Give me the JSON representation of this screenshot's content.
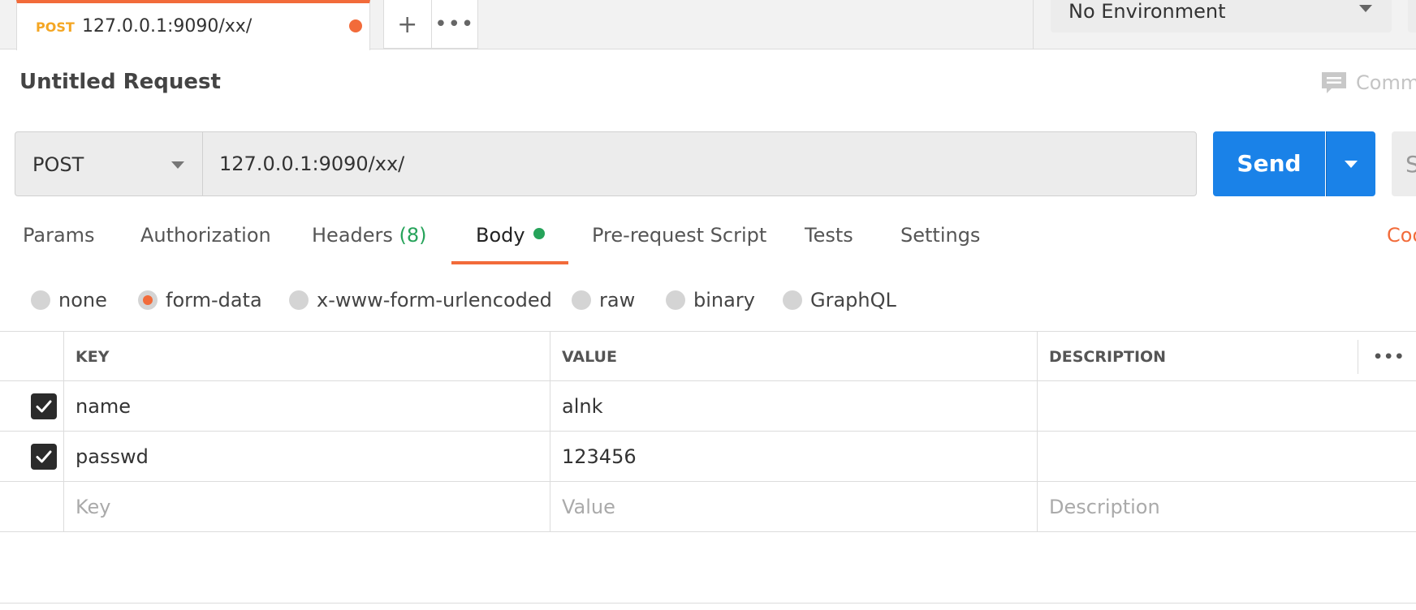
{
  "tabbar": {
    "active_tab": {
      "method": "POST",
      "url": "127.0.0.1:9090/xx/",
      "unsaved": true
    },
    "new_tab_symbol": "+",
    "more_symbol": "•••",
    "environment": "No Environment"
  },
  "request": {
    "title": "Untitled Request",
    "comments_label": "Comm",
    "method": "POST",
    "url": "127.0.0.1:9090/xx/",
    "send_label": "Send",
    "save_label": "S"
  },
  "tabs": [
    {
      "label": "Params"
    },
    {
      "label": "Authorization"
    },
    {
      "label": "Headers",
      "count": "(8)"
    },
    {
      "label": "Body",
      "active": true,
      "has_content": true
    },
    {
      "label": "Pre-request Script"
    },
    {
      "label": "Tests"
    },
    {
      "label": "Settings"
    }
  ],
  "code_link": "Coo",
  "body_modes": [
    {
      "label": "none",
      "selected": false
    },
    {
      "label": "form-data",
      "selected": true
    },
    {
      "label": "x-www-form-urlencoded",
      "selected": false
    },
    {
      "label": "raw",
      "selected": false
    },
    {
      "label": "binary",
      "selected": false
    },
    {
      "label": "GraphQL",
      "selected": false
    }
  ],
  "table": {
    "headers": {
      "key": "KEY",
      "value": "VALUE",
      "description": "DESCRIPTION",
      "more": "•••"
    },
    "rows": [
      {
        "checked": true,
        "key": "name",
        "value": "alnk",
        "description": ""
      },
      {
        "checked": true,
        "key": "passwd",
        "value": "123456",
        "description": ""
      }
    ],
    "placeholders": {
      "key": "Key",
      "value": "Value",
      "description": "Description"
    }
  },
  "colors": {
    "accent": "#f26b3a",
    "post_method": "#f4a623",
    "send": "#1a82e8",
    "success": "#26a35a"
  }
}
